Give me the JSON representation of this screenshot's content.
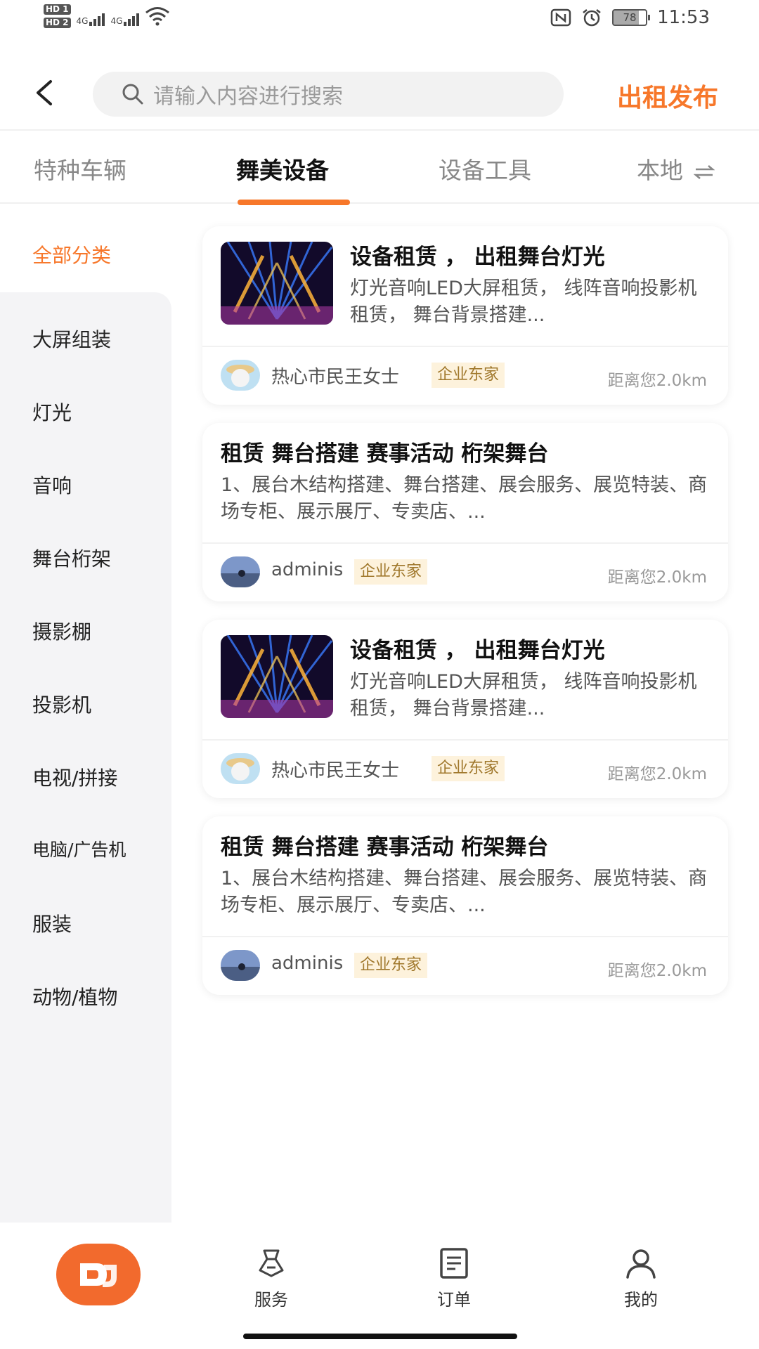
{
  "status_bar": {
    "hd1": "HD 1",
    "hd2": "HD 2",
    "net1": "4G",
    "net2": "4G",
    "battery": "78",
    "time": "11:53"
  },
  "header": {
    "search_placeholder": "请输入内容进行搜索",
    "publish": "出租发布"
  },
  "tabs": [
    {
      "label": "特种车辆"
    },
    {
      "label": "舞美设备"
    },
    {
      "label": "设备工具"
    },
    {
      "label": "本地"
    }
  ],
  "sidebar": {
    "all": "全部分类",
    "items": [
      {
        "label": "大屏组装"
      },
      {
        "label": "灯光"
      },
      {
        "label": "音响"
      },
      {
        "label": "舞台桁架"
      },
      {
        "label": "摄影棚"
      },
      {
        "label": "投影机"
      },
      {
        "label": "电视/拼接"
      },
      {
        "label": "电脑/广告机"
      },
      {
        "label": "服装"
      },
      {
        "label": "动物/植物"
      }
    ]
  },
  "cards": [
    {
      "title": "设备租赁 ， 出租舞台灯光",
      "desc": "灯光音响LED大屏租赁， 线阵音响投影机租赁， 舞台背景搭建...",
      "user": "热心市民王女士",
      "badge": "企业东家",
      "distance": "距离您2.0km"
    },
    {
      "title": "租赁 舞台搭建 赛事活动 桁架舞台",
      "desc": "1、展台木结构搭建、舞台搭建、展会服务、展览特装、商场专柜、展示展厅、专卖店、...",
      "user": "adminis",
      "badge": "企业东家",
      "distance": "距离您2.0km"
    },
    {
      "title": "设备租赁 ， 出租舞台灯光",
      "desc": "灯光音响LED大屏租赁， 线阵音响投影机租赁， 舞台背景搭建...",
      "user": "热心市民王女士",
      "badge": "企业东家",
      "distance": "距离您2.0km"
    },
    {
      "title": "租赁 舞台搭建 赛事活动 桁架舞台",
      "desc": "1、展台木结构搭建、舞台搭建、展会服务、展览特装、商场专柜、展示展厅、专卖店、...",
      "user": "adminis",
      "badge": "企业东家",
      "distance": "距离您2.0km"
    }
  ],
  "bottom_nav": {
    "service": "服务",
    "orders": "订单",
    "mine": "我的"
  },
  "colors": {
    "accent": "#f7772a",
    "badge_bg": "#fdf2dc",
    "badge_text": "#a0782c",
    "sidebar_bg": "#f4f4f6"
  }
}
